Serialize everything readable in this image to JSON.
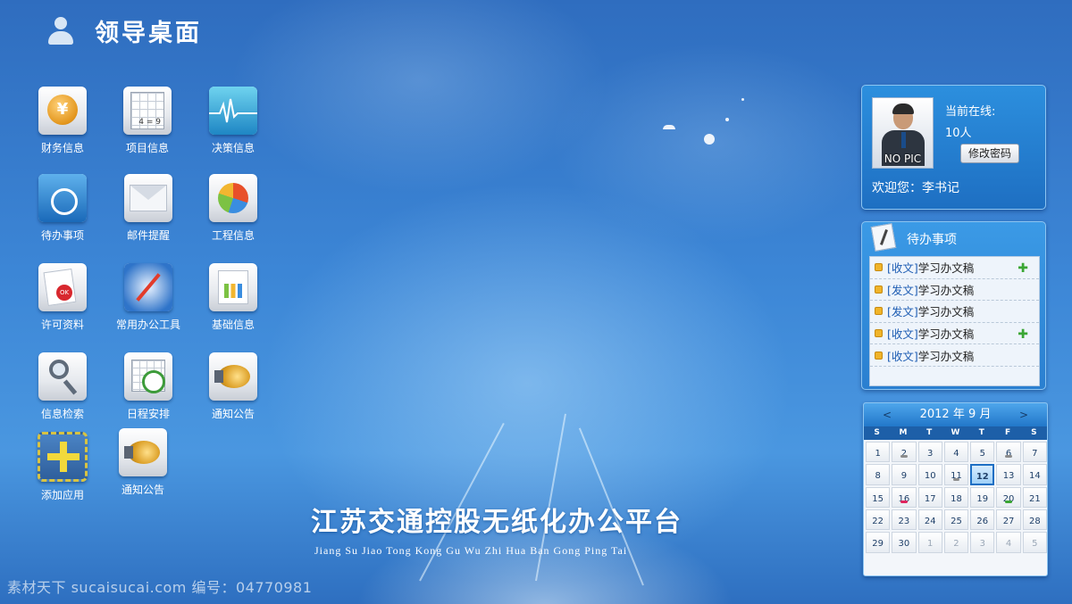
{
  "header": {
    "title": "领导桌面",
    "icon": "user-icon"
  },
  "apps": [
    {
      "label": "财务信息",
      "icon": "coin-icon"
    },
    {
      "label": "项目信息",
      "icon": "spreadsheet-icon"
    },
    {
      "label": "决策信息",
      "icon": "ecg-chart-icon"
    },
    {
      "label": "待办事项",
      "icon": "folder-icon"
    },
    {
      "label": "邮件提醒",
      "icon": "envelope-icon"
    },
    {
      "label": "工程信息",
      "icon": "pie-chart-icon"
    },
    {
      "label": "许可资料",
      "icon": "document-stamp-icon"
    },
    {
      "label": "常用办公工具",
      "icon": "compass-icon"
    },
    {
      "label": "基础信息",
      "icon": "chart-document-icon"
    },
    {
      "label": "信息检索",
      "icon": "magnifier-icon"
    },
    {
      "label": "日程安排",
      "icon": "calendar-clock-icon"
    },
    {
      "label": "通知公告",
      "icon": "speaker-icon"
    },
    {
      "label": "添加应用",
      "icon": "plus-icon"
    },
    {
      "label": "通知公告",
      "icon": "speaker-icon"
    }
  ],
  "tile_glyphs": {
    "coin": "¥",
    "sheet": "4 = 9",
    "stamp": "OK"
  },
  "platform": {
    "title": "江苏交通控股无纸化办公平台",
    "subtitle": "Jiang Su Jiao Tong Kong Gu Wu Zhi Hua Ban Gong Ping Tai"
  },
  "profile": {
    "avatar_text": "NO PIC",
    "online_label": "当前在线:",
    "online_count": "10人",
    "change_password": "修改密码",
    "welcome": "欢迎您：李书记"
  },
  "todo": {
    "title": "待办事项",
    "items": [
      {
        "tag": "[收文]",
        "text": "学习办文稿",
        "has_plus": true
      },
      {
        "tag": "[发文]",
        "text": "学习办文稿",
        "has_plus": false
      },
      {
        "tag": "[发文]",
        "text": "学习办文稿",
        "has_plus": false
      },
      {
        "tag": "[收文]",
        "text": "学习办文稿",
        "has_plus": true
      },
      {
        "tag": "[收文]",
        "text": "学习办文稿",
        "has_plus": false
      }
    ],
    "plus_glyph": "✚"
  },
  "calendar": {
    "title": "2012 年 9 月",
    "prev": "<",
    "next": ">",
    "weekdays": [
      "S",
      "M",
      "T",
      "W",
      "T",
      "F",
      "S"
    ],
    "days": [
      {
        "d": "1",
        "other": false
      },
      {
        "d": "2",
        "other": false,
        "mark": "#8c8c8c"
      },
      {
        "d": "3",
        "other": false
      },
      {
        "d": "4",
        "other": false
      },
      {
        "d": "5",
        "other": false
      },
      {
        "d": "6",
        "other": false,
        "mark": "#8c8c8c"
      },
      {
        "d": "7",
        "other": false
      },
      {
        "d": "8",
        "other": false
      },
      {
        "d": "9",
        "other": false
      },
      {
        "d": "10",
        "other": false
      },
      {
        "d": "11",
        "other": false,
        "mark": "#8c8c8c"
      },
      {
        "d": "12",
        "other": false,
        "today": true
      },
      {
        "d": "13",
        "other": false
      },
      {
        "d": "14",
        "other": false
      },
      {
        "d": "15",
        "other": false
      },
      {
        "d": "16",
        "other": false,
        "mark": "#e0245e"
      },
      {
        "d": "17",
        "other": false
      },
      {
        "d": "18",
        "other": false
      },
      {
        "d": "19",
        "other": false
      },
      {
        "d": "20",
        "other": false,
        "mark": "#3aa634"
      },
      {
        "d": "21",
        "other": false
      },
      {
        "d": "22",
        "other": false
      },
      {
        "d": "23",
        "other": false
      },
      {
        "d": "24",
        "other": false
      },
      {
        "d": "25",
        "other": false
      },
      {
        "d": "26",
        "other": false
      },
      {
        "d": "27",
        "other": false
      },
      {
        "d": "28",
        "other": false
      },
      {
        "d": "29",
        "other": false
      },
      {
        "d": "30",
        "other": false
      },
      {
        "d": "1",
        "other": true
      },
      {
        "d": "2",
        "other": true
      },
      {
        "d": "3",
        "other": true
      },
      {
        "d": "4",
        "other": true
      },
      {
        "d": "5",
        "other": true
      }
    ]
  },
  "watermark": "素材天下 sucaisucai.com  编号：04770981",
  "colors": {
    "accent": "#2c8fde",
    "calendar_today": "#1d6fc4",
    "todo_tag": "#1e5db3"
  }
}
